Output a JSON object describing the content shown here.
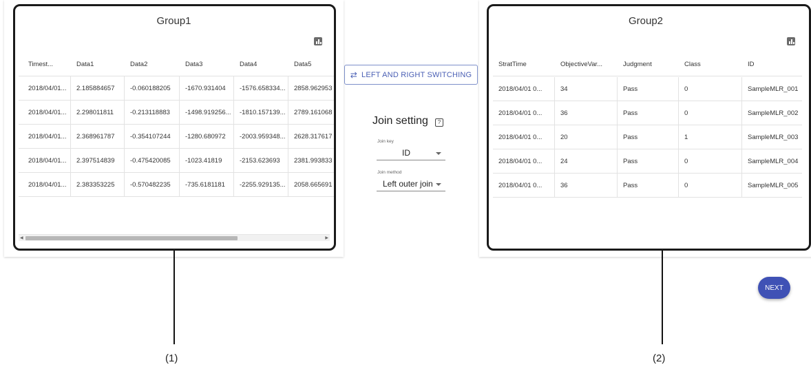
{
  "group1": {
    "title": "Group1",
    "chart_icon": "bar-chart-icon",
    "columns": [
      "Timest...",
      "Data1",
      "Data2",
      "Data3",
      "Data4",
      "Data5"
    ],
    "rows": [
      [
        "2018/04/01...",
        "2.185884657",
        "-0.060188205",
        "-1670.931404",
        "-1576.658334...",
        "2858.962953"
      ],
      [
        "2018/04/01...",
        "2.298011811",
        "-0.213118883",
        "-1498.919256...",
        "-1810.157139...",
        "2789.161068"
      ],
      [
        "2018/04/01...",
        "2.368961787",
        "-0.354107244",
        "-1280.680972",
        "-2003.959348...",
        "2628.317617"
      ],
      [
        "2018/04/01...",
        "2.397514839",
        "-0.475420085",
        "-1023.41819",
        "-2153.623693",
        "2381.993833"
      ],
      [
        "2018/04/01...",
        "2.383353225",
        "-0.570482235",
        "-735.6181181",
        "-2255.929135...",
        "2058.665691"
      ]
    ]
  },
  "group2": {
    "title": "Group2",
    "chart_icon": "bar-chart-icon",
    "columns": [
      "StratTime",
      "ObjectiveVar...",
      "Judgment",
      "Class",
      "ID"
    ],
    "rows": [
      [
        "2018/04/01 0...",
        "34",
        "Pass",
        "0",
        "SampleMLR_001"
      ],
      [
        "2018/04/01 0...",
        "36",
        "Pass",
        "0",
        "SampleMLR_002"
      ],
      [
        "2018/04/01 0...",
        "20",
        "Pass",
        "1",
        "SampleMLR_003"
      ],
      [
        "2018/04/01 0...",
        "24",
        "Pass",
        "0",
        "SampleMLR_004"
      ],
      [
        "2018/04/01 0...",
        "36",
        "Pass",
        "0",
        "SampleMLR_005"
      ]
    ]
  },
  "switch_button": {
    "label": "LEFT AND RIGHT SWITCHING",
    "icon": "swap-arrows-icon"
  },
  "join": {
    "title": "Join setting",
    "help_icon": "help-icon",
    "key_label": "Join key",
    "key_value": "ID",
    "method_label": "Join method",
    "method_value": "Left outer join"
  },
  "next_button": {
    "label": "NEXT"
  },
  "callouts": {
    "left": "(1)",
    "right": "(2)"
  },
  "colors": {
    "accent": "#3f51b5",
    "outline": "#1a1a1a"
  }
}
